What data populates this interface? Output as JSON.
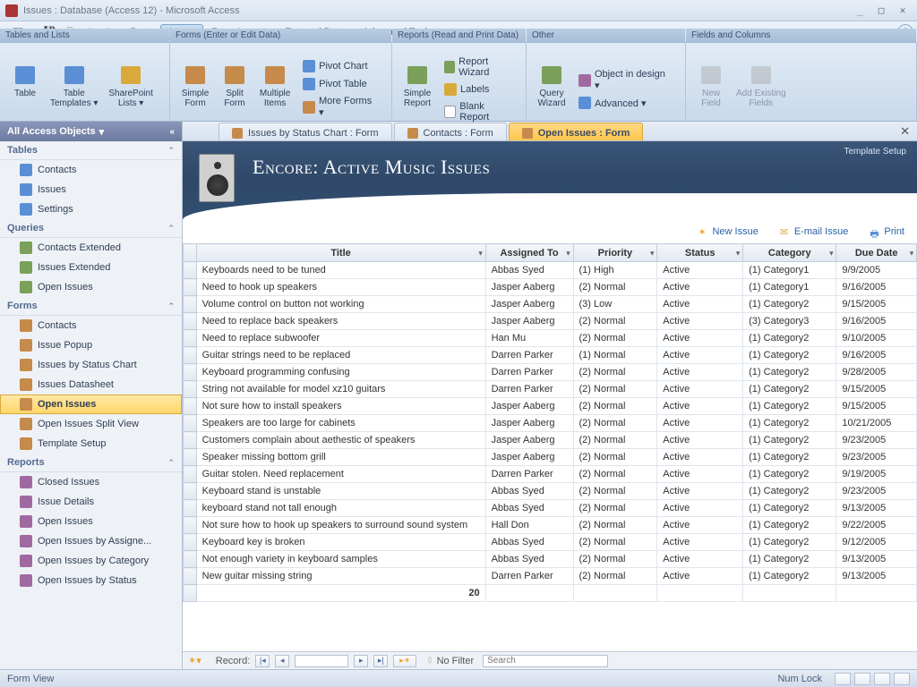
{
  "window": {
    "title": "Issues : Database (Access 12) - Microsoft Access"
  },
  "menu": {
    "file": "File",
    "data": "Data",
    "insert": "Insert",
    "page_layout": "Page Layout",
    "external_data": "External Data",
    "advanced_tools": "Advanced Tools"
  },
  "ribbon": {
    "groups": {
      "tables": "Tables and Lists",
      "forms": "Forms (Enter or Edit Data)",
      "reports": "Reports (Read and Print Data)",
      "other": "Other",
      "fields": "Fields and Columns"
    },
    "table": "Table",
    "table_templates": "Table\nTemplates ▾",
    "sharepoint": "SharePoint\nLists ▾",
    "simple_form": "Simple\nForm",
    "split_form": "Split\nForm",
    "multiple_items": "Multiple\nItems",
    "pivot_chart": "Pivot Chart",
    "pivot_table": "Pivot Table",
    "more_forms": "More Forms ▾",
    "simple_report": "Simple\nReport",
    "report_wizard": "Report Wizard",
    "labels": "Labels",
    "blank_report": "Blank Report",
    "query_wizard": "Query\nWizard",
    "object_design": "Object in design ▾",
    "advanced": "Advanced ▾",
    "new_field": "New\nField",
    "add_existing": "Add Existing\nFields"
  },
  "nav": {
    "header": "All Access Objects",
    "cat_tables": "Tables",
    "cat_queries": "Queries",
    "cat_forms": "Forms",
    "cat_reports": "Reports",
    "tables": [
      "Contacts",
      "Issues",
      "Settings"
    ],
    "queries": [
      "Contacts Extended",
      "Issues Extended",
      "Open Issues"
    ],
    "forms": [
      "Contacts",
      "Issue Popup",
      "Issues by Status Chart",
      "Issues Datasheet",
      "Open Issues",
      "Open Issues Split View",
      "Template Setup"
    ],
    "reports": [
      "Closed Issues",
      "Issue Details",
      "Open Issues",
      "Open Issues by Assigne...",
      "Open Issues by Category",
      "Open Issues by Status"
    ]
  },
  "tabs": {
    "t1": "Issues by Status Chart : Form",
    "t2": "Contacts : Form",
    "t3": "Open Issues : Form"
  },
  "form": {
    "title": "Encore: Active Music Issues",
    "template_setup": "Template Setup",
    "new_issue": "New Issue",
    "email_issue": "E-mail Issue",
    "print": "Print"
  },
  "columns": {
    "title": "Title",
    "assigned": "Assigned To",
    "priority": "Priority",
    "status": "Status",
    "category": "Category",
    "due": "Due Date"
  },
  "rows": [
    {
      "title": "Keyboards need to be tuned",
      "assigned": "Abbas Syed",
      "priority": "(1) High",
      "status": "Active",
      "category": "(1) Category1",
      "due": "9/9/2005"
    },
    {
      "title": "Need to hook up speakers",
      "assigned": "Jasper Aaberg",
      "priority": "(2) Normal",
      "status": "Active",
      "category": "(1) Category1",
      "due": "9/16/2005"
    },
    {
      "title": "Volume control on button not working",
      "assigned": "Jasper Aaberg",
      "priority": "(3) Low",
      "status": "Active",
      "category": "(1) Category2",
      "due": "9/15/2005"
    },
    {
      "title": "Need to replace back speakers",
      "assigned": "Jasper Aaberg",
      "priority": "(2) Normal",
      "status": "Active",
      "category": "(3) Category3",
      "due": "9/16/2005"
    },
    {
      "title": "Need to replace subwoofer",
      "assigned": "Han Mu",
      "priority": "(2) Normal",
      "status": "Active",
      "category": "(1) Category2",
      "due": "9/10/2005"
    },
    {
      "title": "Guitar strings need to be replaced",
      "assigned": "Darren Parker",
      "priority": "(1) Normal",
      "status": "Active",
      "category": "(1) Category2",
      "due": "9/16/2005"
    },
    {
      "title": "Keyboard programming confusing",
      "assigned": "Darren Parker",
      "priority": "(2) Normal",
      "status": "Active",
      "category": "(1) Category2",
      "due": "9/28/2005"
    },
    {
      "title": "String not available for model xz10 guitars",
      "assigned": "Darren Parker",
      "priority": "(2) Normal",
      "status": "Active",
      "category": "(1) Category2",
      "due": "9/15/2005"
    },
    {
      "title": "Not sure how to install speakers",
      "assigned": "Jasper Aaberg",
      "priority": "(2) Normal",
      "status": "Active",
      "category": "(1) Category2",
      "due": "9/15/2005"
    },
    {
      "title": "Speakers are too large for cabinets",
      "assigned": "Jasper Aaberg",
      "priority": "(2) Normal",
      "status": "Active",
      "category": "(1) Category2",
      "due": "10/21/2005"
    },
    {
      "title": "Customers complain about aethestic of speakers",
      "assigned": "Jasper Aaberg",
      "priority": "(2) Normal",
      "status": "Active",
      "category": "(1) Category2",
      "due": "9/23/2005"
    },
    {
      "title": "Speaker missing bottom grill",
      "assigned": "Jasper Aaberg",
      "priority": "(2) Normal",
      "status": "Active",
      "category": "(1) Category2",
      "due": "9/23/2005"
    },
    {
      "title": "Guitar stolen. Need replacement",
      "assigned": "Darren Parker",
      "priority": "(2) Normal",
      "status": "Active",
      "category": "(1) Category2",
      "due": "9/19/2005"
    },
    {
      "title": "Keyboard stand is unstable",
      "assigned": "Abbas Syed",
      "priority": "(2) Normal",
      "status": "Active",
      "category": "(1) Category2",
      "due": "9/23/2005"
    },
    {
      "title": "keyboard stand not tall enough",
      "assigned": "Abbas Syed",
      "priority": "(2) Normal",
      "status": "Active",
      "category": "(1) Category2",
      "due": "9/13/2005"
    },
    {
      "title": "Not sure how to hook up speakers to surround sound system",
      "assigned": "Hall Don",
      "priority": "(2) Normal",
      "status": "Active",
      "category": "(1) Category2",
      "due": "9/22/2005"
    },
    {
      "title": "Keyboard key is broken",
      "assigned": "Abbas Syed",
      "priority": "(2) Normal",
      "status": "Active",
      "category": "(1) Category2",
      "due": "9/12/2005"
    },
    {
      "title": "Not enough variety in keyboard samples",
      "assigned": "Abbas Syed",
      "priority": "(2) Normal",
      "status": "Active",
      "category": "(1) Category2",
      "due": "9/13/2005"
    },
    {
      "title": "New guitar missing string",
      "assigned": "Darren Parker",
      "priority": "(2) Normal",
      "status": "Active",
      "category": "(1) Category2",
      "due": "9/13/2005"
    }
  ],
  "total_count": "20",
  "recordnav": {
    "label": "Record:",
    "no_filter": "No Filter",
    "search": "Search"
  },
  "statusbar": {
    "view": "Form View",
    "numlock": "Num Lock"
  }
}
